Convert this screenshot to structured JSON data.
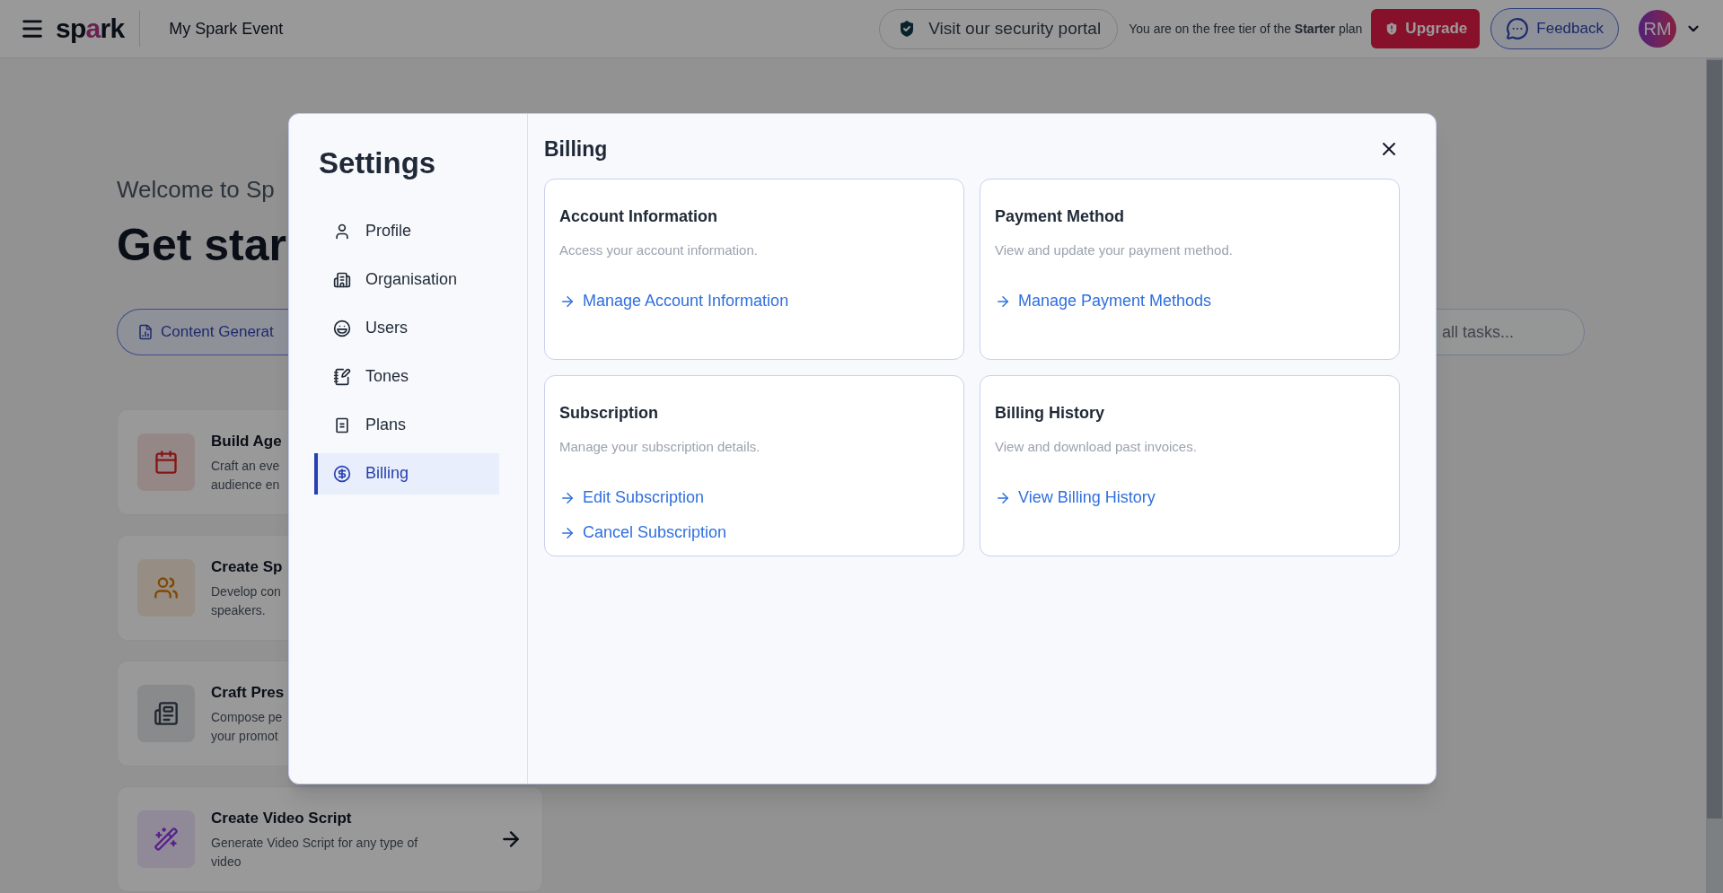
{
  "top_bar": {
    "logo": [
      {
        "text": "sp"
      },
      {
        "text": "a"
      },
      {
        "text": "rk"
      }
    ],
    "event_name": "My Spark Event",
    "security_link": "Visit our security portal",
    "tier_notice": "You are on the free tier of the **Starter** plan",
    "upgrade_button": "Upgrade",
    "feedback_button": "Feedback",
    "avatar": "RM"
  },
  "background": {
    "welcome": "Welcome to Sp",
    "heading": "Get star",
    "category_tab": "Content Generat",
    "search": {
      "placeholder": "all tasks..."
    },
    "tasks": [
      {
        "title": "Build Age",
        "description": [
          "Craft an eve",
          "audience en"
        ]
      },
      {
        "title": "Create Sp",
        "description": [
          "Develop con",
          "speakers."
        ]
      },
      {
        "title": "Craft Pres",
        "description": [
          "Compose pe",
          "your promot"
        ]
      },
      {
        "title": "Create Video Script",
        "description": [
          "Generate Video Script for any type of",
          "video"
        ]
      }
    ]
  },
  "settings": {
    "title": "Settings",
    "nav": [
      {
        "label": "Profile",
        "selected": false
      },
      {
        "label": "Organisation",
        "selected": false
      },
      {
        "label": "Users",
        "selected": false
      },
      {
        "label": "Tones",
        "selected": false
      },
      {
        "label": "Plans",
        "selected": false
      },
      {
        "label": "Billing",
        "selected": true
      }
    ],
    "section_title": "Billing",
    "cards": [
      {
        "title": "Account Information",
        "description": "Access your account information.",
        "links": [
          "Manage Account Information"
        ]
      },
      {
        "title": "Payment Method",
        "description": "View and update your payment method.",
        "links": [
          "Manage Payment Methods"
        ]
      },
      {
        "title": "Subscription",
        "description": "Manage your subscription details.",
        "links": [
          "Edit Subscription",
          "Cancel Subscription"
        ]
      },
      {
        "title": "Billing History",
        "description": "View and download past invoices.",
        "links": [
          "View Billing History"
        ]
      }
    ]
  }
}
